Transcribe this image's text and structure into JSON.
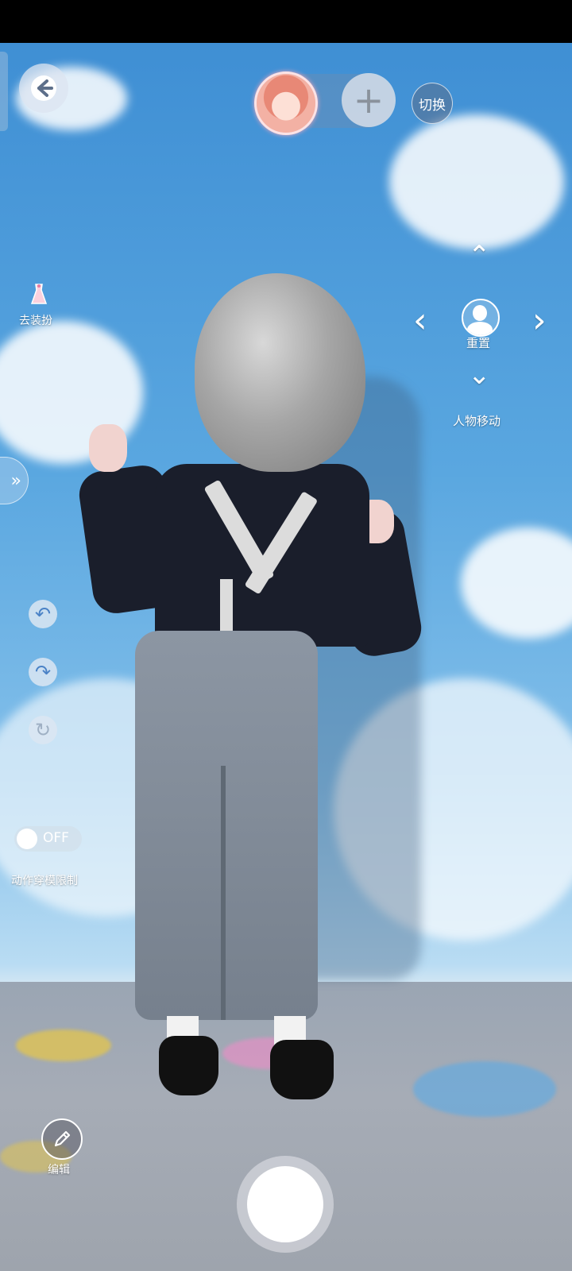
{
  "header": {
    "back_icon": "arrow-left-icon",
    "avatar_icon": "character-avatar",
    "add_icon": "plus-icon",
    "switch_label": "切换"
  },
  "sidebar_left": {
    "dress_icon": "dress-icon",
    "dress_label": "去装扮",
    "expand_icon": "double-chevron-right-icon",
    "tools": [
      {
        "name": "undo",
        "icon": "undo-icon",
        "glyph": "↶"
      },
      {
        "name": "redo",
        "icon": "redo-icon",
        "glyph": "↷"
      },
      {
        "name": "reset-pose",
        "icon": "rotate-icon",
        "glyph": "↻"
      }
    ],
    "toggle": {
      "state_text": "OFF",
      "label": "动作穿模限制"
    },
    "edit_label": "编辑",
    "edit_icon": "pencil-icon"
  },
  "move_control": {
    "up": "⌃",
    "left": "‹",
    "right": "›",
    "down": "⌄",
    "reset_label": "重置",
    "reset_icon": "person-icon",
    "title": "人物移动"
  },
  "capture": {
    "shutter_icon": "shutter-button"
  }
}
